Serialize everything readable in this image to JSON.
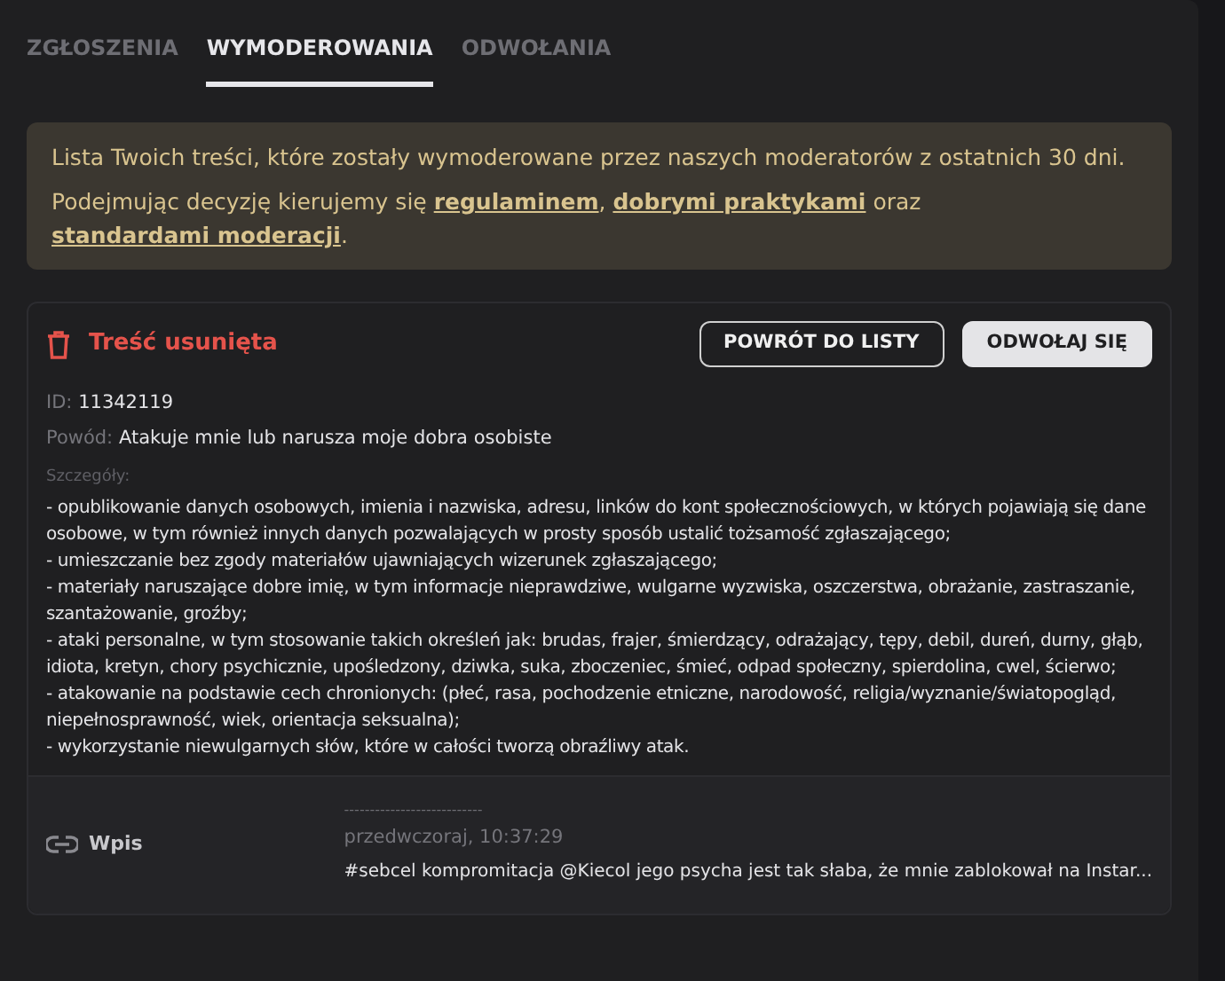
{
  "tabs": [
    {
      "label": "ZGŁOSZENIA",
      "selected": false
    },
    {
      "label": "WYMODEROWANIA",
      "selected": true
    },
    {
      "label": "ODWOŁANIA",
      "selected": false
    }
  ],
  "notice": {
    "line_1": "Lista Twoich treści, które zostały wymoderowane przez naszych moderatorów z ostatnich 30 dni.",
    "line_2": [
      {
        "kind": "text",
        "text": "Podejmując decyzję kierujemy się "
      },
      {
        "kind": "link",
        "text": "regulaminem"
      },
      {
        "kind": "text",
        "text": ", "
      },
      {
        "kind": "link",
        "text": "dobrymi praktykami"
      },
      {
        "kind": "text",
        "text": " oraz "
      },
      {
        "kind": "link",
        "text": "standardami moderacji"
      },
      {
        "kind": "text",
        "text": "."
      }
    ]
  },
  "card": {
    "status": "Treść usunięta",
    "buttons": [
      {
        "label": "POWRÓT DO LISTY",
        "kind": "outline"
      },
      {
        "label": "ODWOŁAJ SIĘ",
        "kind": "filled"
      }
    ],
    "id_label": "ID:",
    "id_value": "11342119",
    "reason_label": "Powód:",
    "reason_value": "Atakuje mnie lub narusza moje dobra osobiste",
    "details_label": "Szczegóły:",
    "details": [
      "- opublikowanie danych osobowych, imienia i nazwiska, adresu, linków do kont społecznościowych, w których pojawiają się dane osobowe, w tym również innych danych pozwalających w prosty sposób ustalić tożsamość zgłaszającego;",
      "- umieszczanie bez zgody materiałów ujawniających wizerunek zgłaszającego;",
      "- materiały naruszające dobre imię, w tym informacje nieprawdziwe, wulgarne wyzwiska, oszczerstwa, obrażanie, zastraszanie, szantażowanie, groźby;",
      "- ataki personalne, w tym stosowanie takich określeń jak: brudas, frajer, śmierdzący, odrażający, tępy, debil, dureń, durny, głąb, idiota, kretyn, chory psychicznie, upośledzony, dziwka, suka, zboczeniec, śmieć, odpad społeczny, spierdolina, cwel, ścierwo;",
      "- atakowanie na podstawie cech chronionych: (płeć, rasa, pochodzenie etniczne, narodowość, religia/wyznanie/światopogląd, niepełnosprawność, wiek, orientacja seksualna);",
      "- wykorzystanie niewulgarnych słów, które w całości tworzą obraźliwy atak."
    ]
  },
  "entry": {
    "type": "Wpis",
    "separator": "---------------------------",
    "date": "przedwczoraj, 10:37:29",
    "excerpt": "#sebcel kompromitacja @Kiecol jego psycha jest tak słaba, że mnie zablokował na Instar..."
  }
}
